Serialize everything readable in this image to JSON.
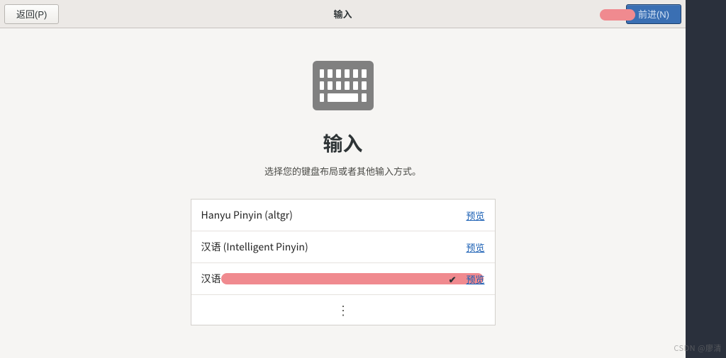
{
  "header": {
    "back_label": "返回(P)",
    "title": "输入",
    "forward_label": "前进(N)"
  },
  "page": {
    "heading": "输入",
    "subheading": "选择您的键盘布局或者其他输入方式。"
  },
  "layouts": [
    {
      "name": "Hanyu Pinyin (altgr)",
      "preview": "预览",
      "selected": false,
      "marked": false
    },
    {
      "name": "汉语  (Intelligent Pinyin)",
      "preview": "预览",
      "selected": false,
      "marked": false
    },
    {
      "name": "汉语",
      "preview": "预览",
      "selected": true,
      "marked": true
    }
  ],
  "more_glyph": "⋮",
  "check_glyph": "✔",
  "watermark": "CSDN @廖清"
}
